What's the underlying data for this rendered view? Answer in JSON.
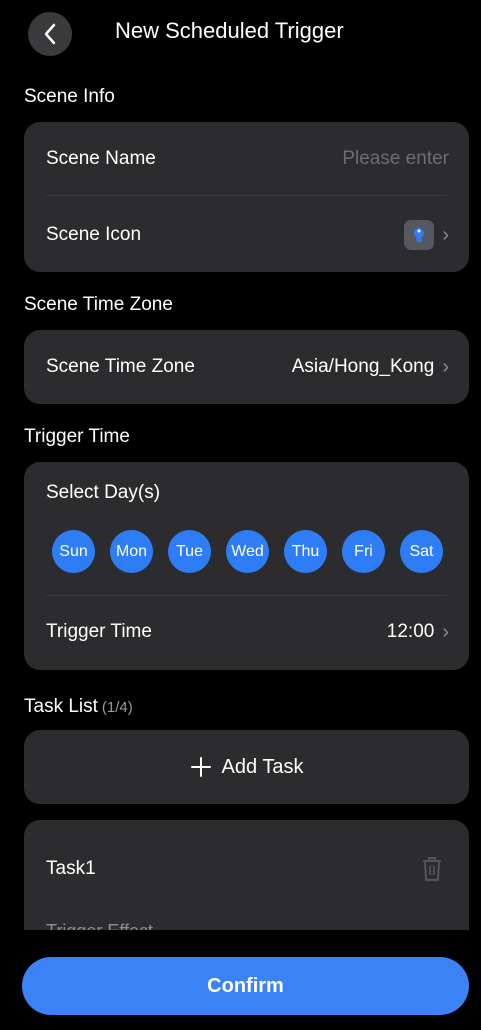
{
  "header": {
    "title": "New Scheduled Trigger"
  },
  "scene_info": {
    "label": "Scene Info",
    "name_label": "Scene Name",
    "name_placeholder": "Please enter",
    "icon_label": "Scene Icon"
  },
  "time_zone": {
    "label": "Scene Time Zone",
    "row_label": "Scene Time Zone",
    "value": "Asia/Hong_Kong"
  },
  "trigger_time": {
    "label": "Trigger Time",
    "select_days_label": "Select Day(s)",
    "days": [
      "Sun",
      "Mon",
      "Tue",
      "Wed",
      "Thu",
      "Fri",
      "Sat"
    ],
    "row_label": "Trigger Time",
    "value": "12:00"
  },
  "task_list": {
    "label": "Task List",
    "count": "(1/4)",
    "add_label": "Add Task",
    "task1_label": "Task1",
    "task1_subtitle": "Trigger Effect"
  },
  "footer": {
    "confirm_label": "Confirm"
  },
  "colors": {
    "accent": "#2f7df6",
    "card": "#2c2c2e",
    "background": "#000000"
  }
}
